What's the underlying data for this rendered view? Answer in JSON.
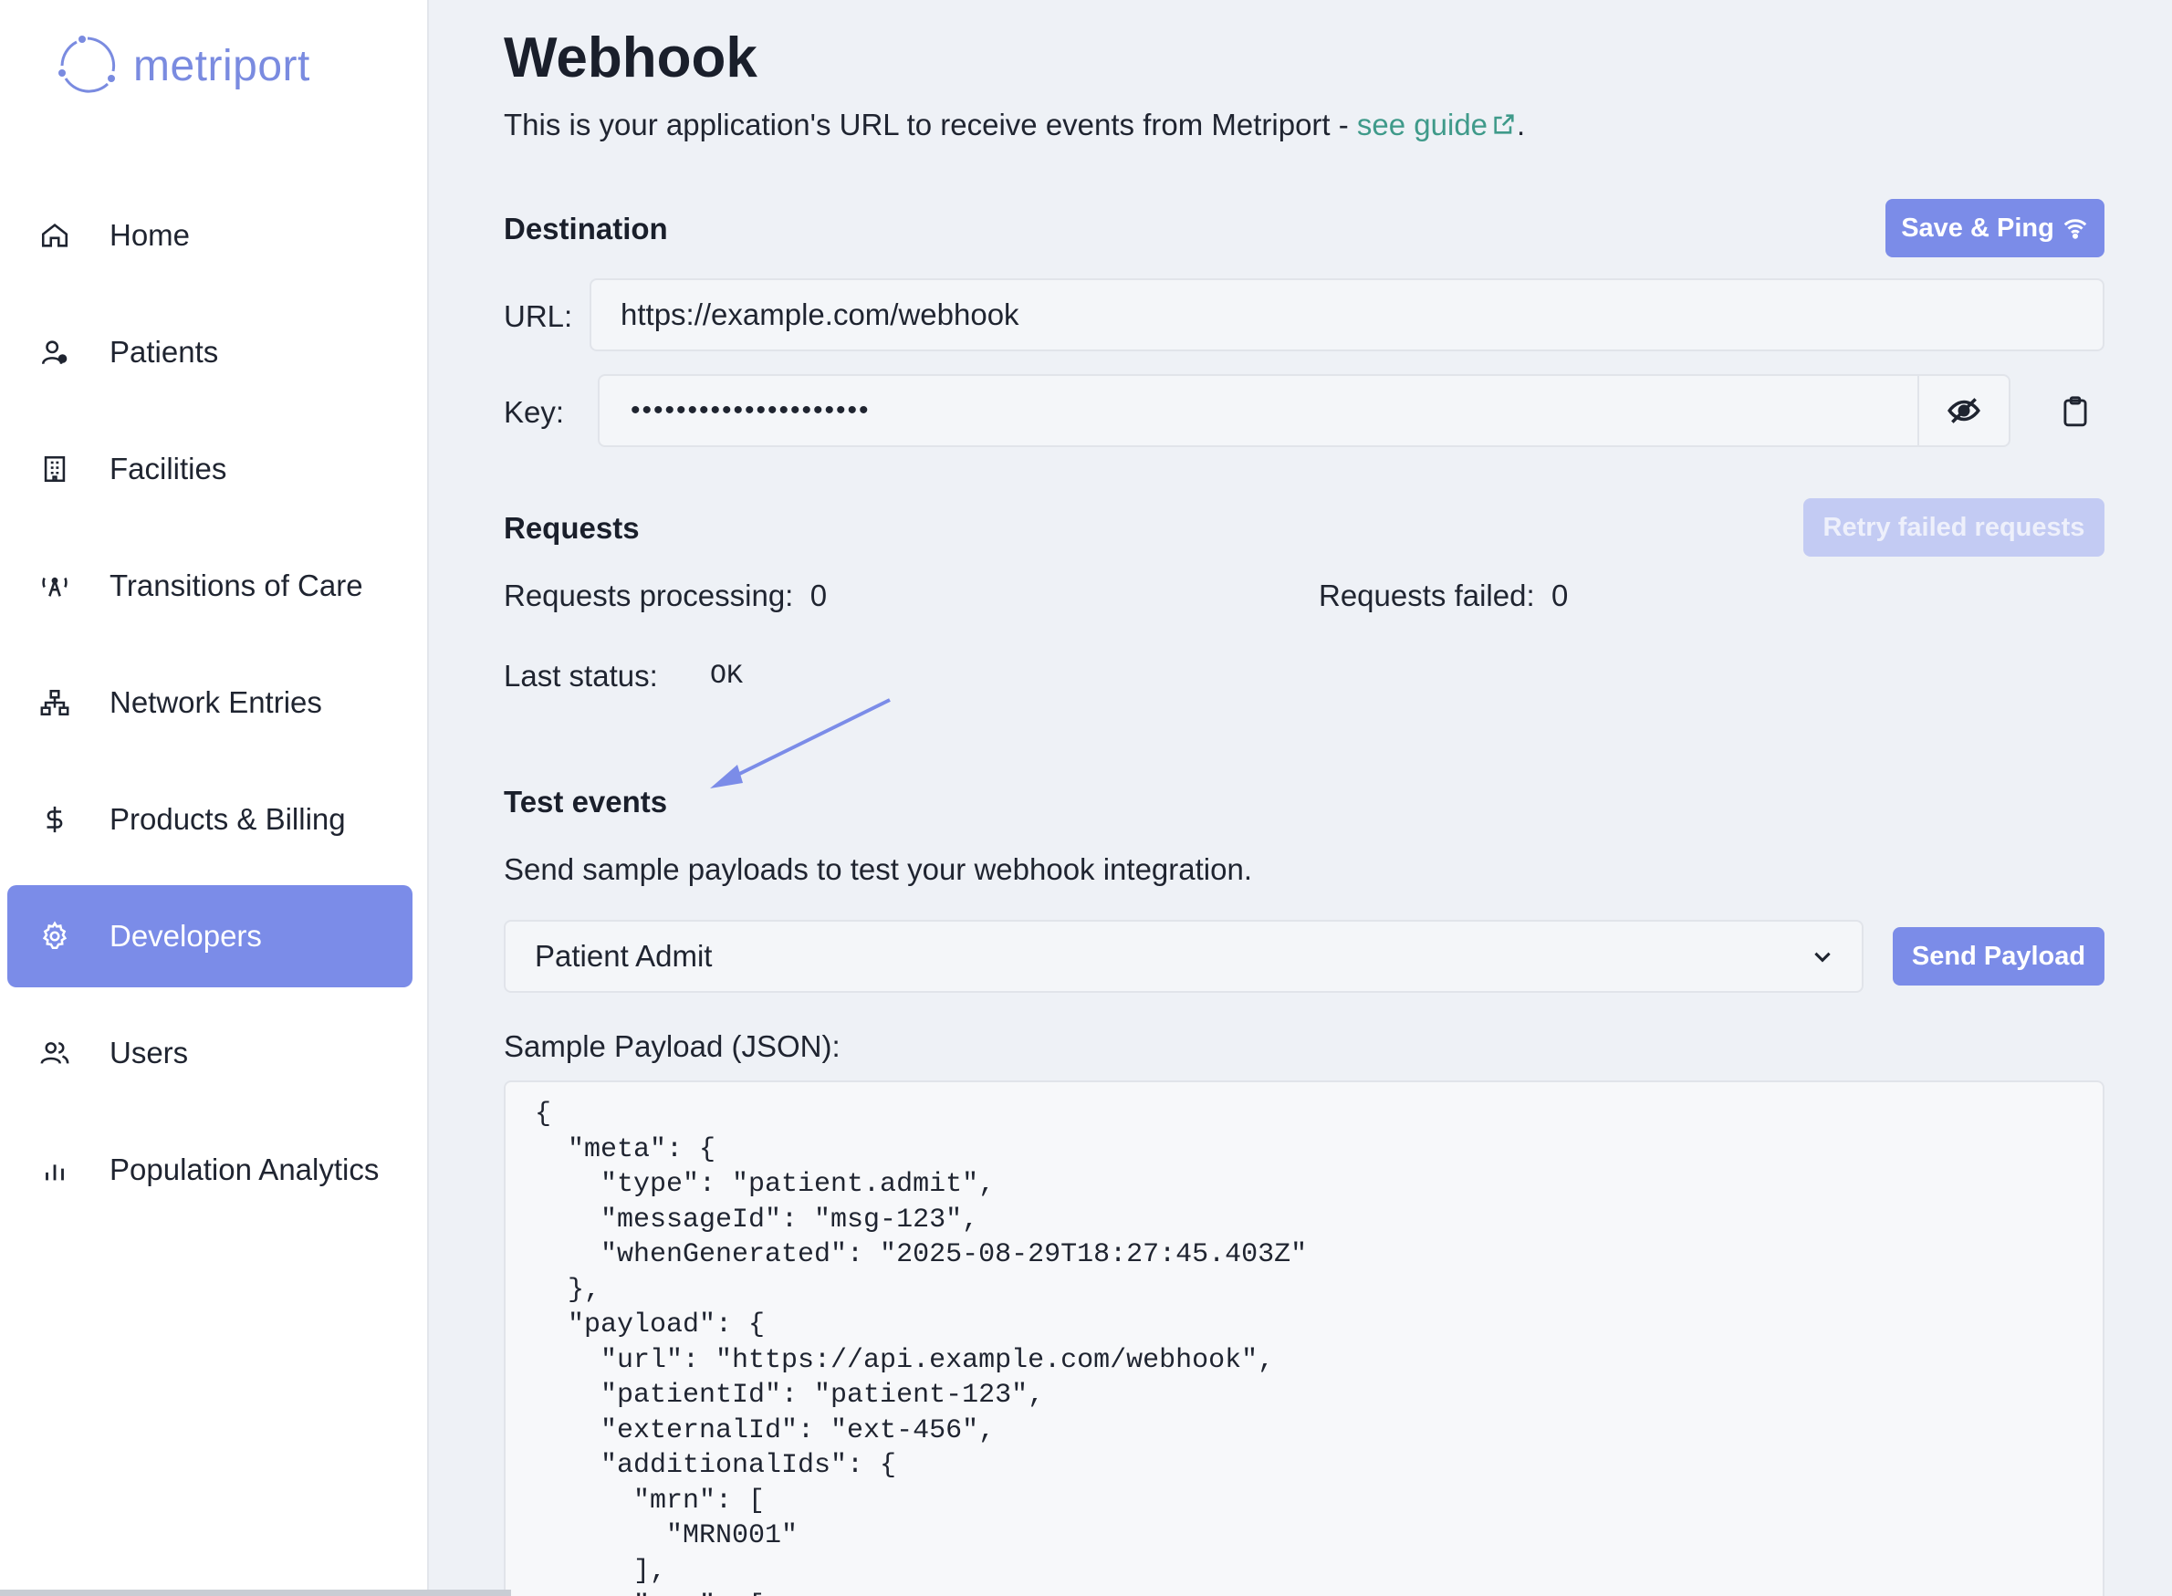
{
  "brand": {
    "name": "metriport",
    "accent": "#7b8ce8"
  },
  "sidebar": {
    "items": [
      {
        "label": "Home",
        "icon": "home-icon"
      },
      {
        "label": "Patients",
        "icon": "patient-icon"
      },
      {
        "label": "Facilities",
        "icon": "building-icon"
      },
      {
        "label": "Transitions of Care",
        "icon": "broadcast-icon"
      },
      {
        "label": "Network Entries",
        "icon": "network-icon"
      },
      {
        "label": "Products & Billing",
        "icon": "dollar-icon"
      },
      {
        "label": "Developers",
        "icon": "gear-icon",
        "active": true
      },
      {
        "label": "Users",
        "icon": "users-icon"
      },
      {
        "label": "Population Analytics",
        "icon": "bar-chart-icon"
      }
    ]
  },
  "page": {
    "title": "Webhook",
    "subtitle_prefix": "This is your application's URL to receive events from Metriport - ",
    "subtitle_link": "see guide",
    "subtitle_suffix": "."
  },
  "destination": {
    "title": "Destination",
    "save_ping_label": "Save & Ping",
    "url_label": "URL:",
    "url_value": "https://example.com/webhook",
    "key_label": "Key:",
    "key_masked": "•••••••••••••••••••••"
  },
  "requests": {
    "title": "Requests",
    "retry_label": "Retry failed requests",
    "processing_label": "Requests processing:",
    "processing_value": "0",
    "failed_label": "Requests failed:",
    "failed_value": "0",
    "last_status_label": "Last status:",
    "last_status_value": "OK"
  },
  "test_events": {
    "title": "Test events",
    "description": "Send sample payloads to test your webhook integration.",
    "selected_event": "Patient Admit",
    "send_label": "Send Payload",
    "payload_label": "Sample Payload (JSON):",
    "payload_text": "{\n  \"meta\": {\n    \"type\": \"patient.admit\",\n    \"messageId\": \"msg-123\",\n    \"whenGenerated\": \"2025-08-29T18:27:45.403Z\"\n  },\n  \"payload\": {\n    \"url\": \"https://api.example.com/webhook\",\n    \"patientId\": \"patient-123\",\n    \"externalId\": \"ext-456\",\n    \"additionalIds\": {\n      \"mrn\": [\n        \"MRN001\"\n      ],\n      \"ssn\": ["
  }
}
